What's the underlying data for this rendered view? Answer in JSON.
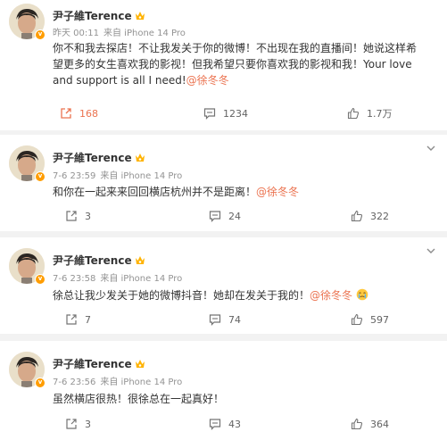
{
  "posts": [
    {
      "author": "尹子維Terence",
      "time": "昨天 00:11",
      "source": "来自 iPhone 14 Pro",
      "text_plain": "你不和我去探店！不让我发关于你的微博！不出现在我的直播间！她说这样希望更多的女生喜欢我的影视！但我希望只要你喜欢我的影视和我！Your love and support is all I need!",
      "mention": "@徐冬冬",
      "shares": "168",
      "comments": "1234",
      "likes": "1.7万",
      "share_active": true
    },
    {
      "author": "尹子維Terence",
      "time": "7-6 23:59",
      "source": "来自 iPhone 14 Pro",
      "text_plain": "和你在一起来来回回横店杭州并不是距离！",
      "mention": "@徐冬冬",
      "shares": "3",
      "comments": "24",
      "likes": "322",
      "share_active": false
    },
    {
      "author": "尹子維Terence",
      "time": "7-6 23:58",
      "source": "来自 iPhone 14 Pro",
      "text_plain": "徐总让我少发关于她的微博抖音！她却在发关于我的！",
      "mention": "@徐冬冬",
      "shares": "7",
      "comments": "74",
      "likes": "597",
      "share_active": false,
      "emoji": "crying-emoji"
    },
    {
      "author": "尹子維Terence",
      "time": "7-6 23:56",
      "source": "来自 iPhone 14 Pro",
      "text_plain": "虽然横店很热！很徐总在一起真好！",
      "mention": "",
      "shares": "3",
      "comments": "43",
      "likes": "364",
      "share_active": false
    }
  ],
  "colors": {
    "accent": "#eb7350",
    "badge": "#ff9d00",
    "meta_text": "#939393",
    "background": "#f2f2f2"
  },
  "icons": [
    "verified-badge-icon",
    "crown-icon",
    "chevron-down-icon",
    "share-icon",
    "comment-icon",
    "like-icon"
  ]
}
